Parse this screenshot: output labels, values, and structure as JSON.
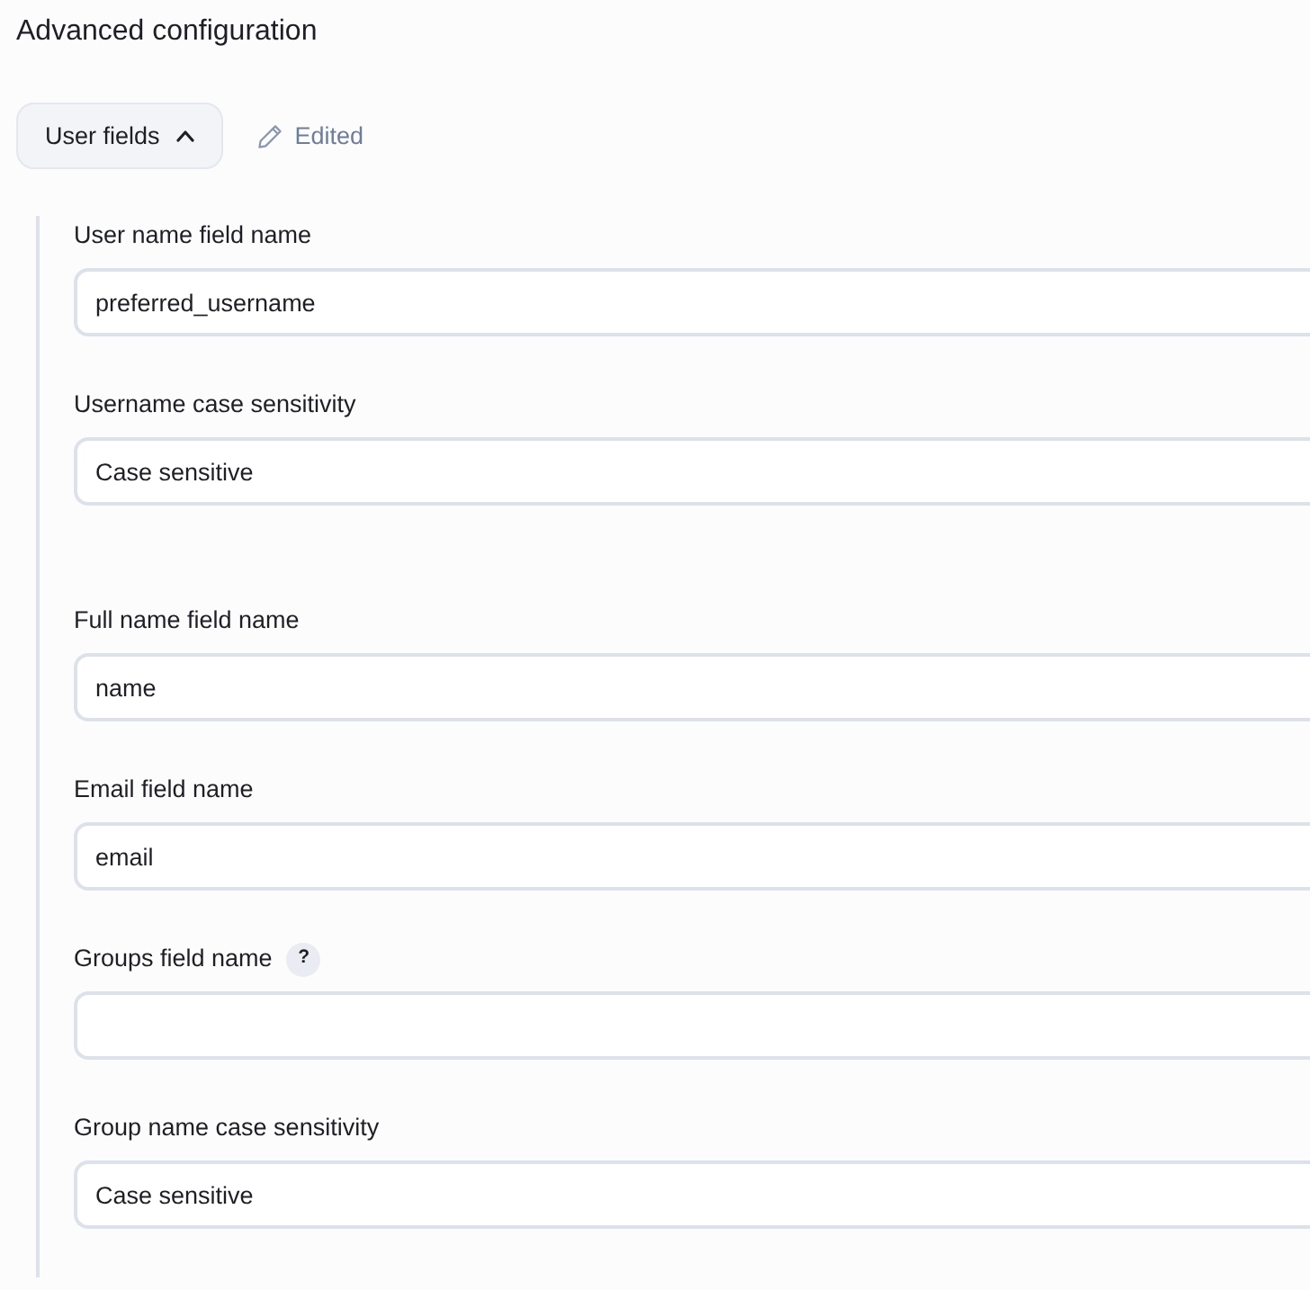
{
  "title": "Advanced configuration",
  "section": {
    "toggle": {
      "label": "User fields",
      "expanded": true
    },
    "status": {
      "label": "Edited"
    },
    "groups": [
      {
        "fields": [
          {
            "label": "User name field name",
            "value": "preferred_username"
          },
          {
            "label": "Username case sensitivity",
            "value": "Case sensitive"
          }
        ]
      },
      {
        "fields": [
          {
            "label": "Full name field name",
            "value": "name"
          },
          {
            "label": "Email field name",
            "value": "email"
          },
          {
            "label": "Groups field name",
            "help": "?"
          },
          {
            "label": "Group name case sensitivity",
            "value": "Case sensitive"
          }
        ]
      }
    ]
  }
}
